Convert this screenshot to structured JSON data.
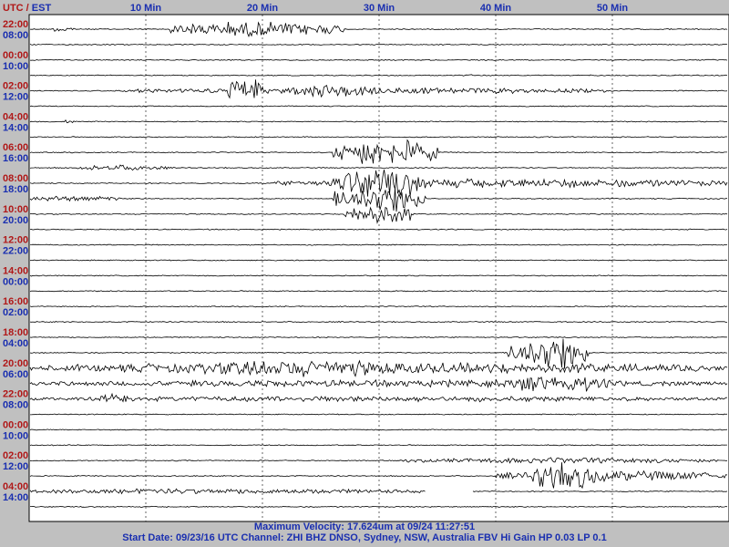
{
  "chart_data": {
    "type": "line",
    "title": "",
    "header_label": "UTC / EST",
    "x_axis": {
      "unit": "Min",
      "range": [
        0,
        60
      ],
      "tick_labels": [
        "10 Min",
        "20 Min",
        "30 Min",
        "40 Min",
        "50 Min"
      ],
      "tick_values": [
        10,
        20,
        30,
        40,
        50
      ],
      "grid": "dashed-vertical"
    },
    "colors": {
      "utc_label": "#b01818",
      "est_label": "#1a2fb0",
      "trace": "#000000",
      "background": "#ffffff",
      "frame": "#c0c0c0",
      "footer_text": "#1a2fb0"
    },
    "rows": [
      {
        "utc": "22:00",
        "est": "08:00"
      },
      {
        "utc": "00:00",
        "est": "10:00"
      },
      {
        "utc": "02:00",
        "est": "12:00"
      },
      {
        "utc": "04:00",
        "est": "14:00"
      },
      {
        "utc": "06:00",
        "est": "16:00"
      },
      {
        "utc": "08:00",
        "est": "18:00"
      },
      {
        "utc": "10:00",
        "est": "20:00"
      },
      {
        "utc": "12:00",
        "est": "22:00"
      },
      {
        "utc": "14:00",
        "est": "00:00"
      },
      {
        "utc": "16:00",
        "est": "02:00"
      },
      {
        "utc": "18:00",
        "est": "04:00"
      },
      {
        "utc": "20:00",
        "est": "06:00"
      },
      {
        "utc": "22:00",
        "est": "08:00"
      },
      {
        "utc": "00:00",
        "est": "10:00"
      },
      {
        "utc": "02:00",
        "est": "12:00"
      },
      {
        "utc": "04:00",
        "est": "14:00"
      }
    ],
    "trace_count": 32,
    "activity_bursts": [
      {
        "trace": 0,
        "start_min": 2,
        "end_min": 4,
        "amp": 1.2
      },
      {
        "trace": 0,
        "start_min": 12,
        "end_min": 27,
        "amp": 2.2
      },
      {
        "trace": 3,
        "start_min": 37,
        "end_min": 38,
        "amp": 0.4
      },
      {
        "trace": 4,
        "start_min": 8,
        "end_min": 50,
        "amp": 0.9
      },
      {
        "trace": 4,
        "start_min": 17,
        "end_min": 20,
        "amp": 4.0
      },
      {
        "trace": 4,
        "start_min": 22,
        "end_min": 30,
        "amp": 2.0
      },
      {
        "trace": 6,
        "start_min": 3,
        "end_min": 4,
        "amp": 0.6
      },
      {
        "trace": 8,
        "start_min": 26,
        "end_min": 35,
        "amp": 4.0
      },
      {
        "trace": 9,
        "start_min": 4,
        "end_min": 12,
        "amp": 0.8
      },
      {
        "trace": 10,
        "start_min": 21,
        "end_min": 60,
        "amp": 1.3
      },
      {
        "trace": 10,
        "start_min": 26,
        "end_min": 34,
        "amp": 4.5
      },
      {
        "trace": 11,
        "start_min": 0,
        "end_min": 8,
        "amp": 0.8
      },
      {
        "trace": 11,
        "start_min": 26,
        "end_min": 34,
        "amp": 4.0
      },
      {
        "trace": 12,
        "start_min": 27,
        "end_min": 33,
        "amp": 3.0
      },
      {
        "trace": 21,
        "start_min": 41,
        "end_min": 48,
        "amp": 5.0
      },
      {
        "trace": 22,
        "start_min": 0,
        "end_min": 60,
        "amp": 1.6
      },
      {
        "trace": 22,
        "start_min": 14,
        "end_min": 33,
        "amp": 2.5
      },
      {
        "trace": 23,
        "start_min": 0,
        "end_min": 60,
        "amp": 1.0
      },
      {
        "trace": 23,
        "start_min": 40,
        "end_min": 50,
        "amp": 2.5
      },
      {
        "trace": 24,
        "start_min": 0,
        "end_min": 60,
        "amp": 0.8
      },
      {
        "trace": 24,
        "start_min": 6,
        "end_min": 9,
        "amp": 1.5
      },
      {
        "trace": 28,
        "start_min": 32,
        "end_min": 60,
        "amp": 0.8
      },
      {
        "trace": 29,
        "start_min": 40,
        "end_min": 60,
        "amp": 1.5
      },
      {
        "trace": 29,
        "start_min": 43,
        "end_min": 49,
        "amp": 4.0
      },
      {
        "trace": 30,
        "start_min": 0,
        "end_min": 34,
        "amp": 0.8
      }
    ],
    "gap": {
      "trace": 30,
      "start_min": 34,
      "end_min": 38
    }
  },
  "footer": {
    "line1": "Maximum Velocity: 17.624um at 09/24 11:27:51",
    "line2": "Start Date: 09/23/16 UTC Channel: ZHI  BHZ  DNSO, Sydney, NSW, Australia  FBV Hi Gain HP 0.03  LP 0.1"
  }
}
